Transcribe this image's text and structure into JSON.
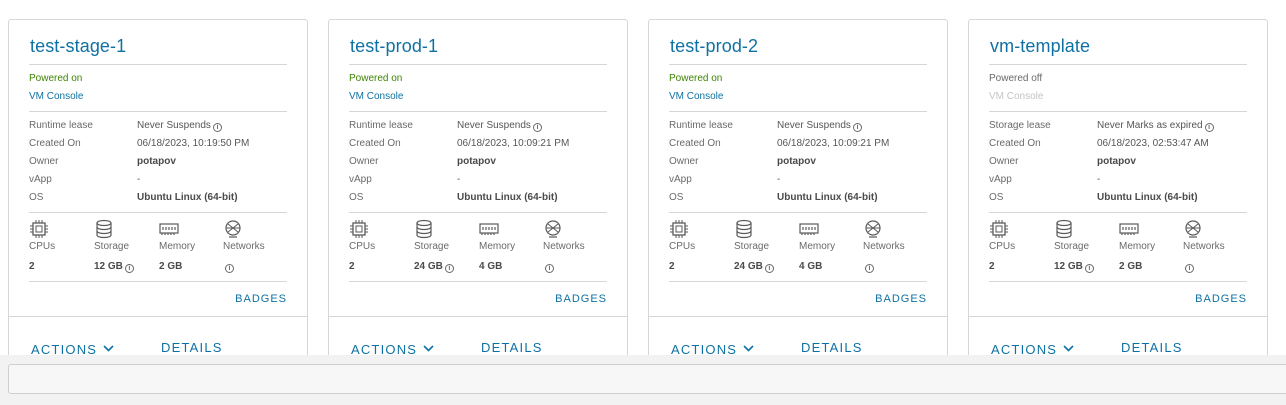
{
  "colors": {
    "link": "#0f71a3",
    "powered_on": "#3c8500",
    "border": "#d7d7d7"
  },
  "labels": {
    "runtime_lease": "Runtime lease",
    "storage_lease": "Storage lease",
    "created_on": "Created On",
    "owner": "Owner",
    "vapp": "vApp",
    "os": "OS",
    "cpus": "CPUs",
    "storage": "Storage",
    "memory": "Memory",
    "networks": "Networks",
    "badges": "BADGES",
    "actions": "ACTIONS",
    "details": "DETAILS",
    "vm_console": "VM Console"
  },
  "cards": [
    {
      "name": "test-stage-1",
      "status": "Powered on",
      "lease_label": "Runtime lease",
      "lease_value": "Never Suspends",
      "created_on": "06/18/2023, 10:19:50 PM",
      "owner": "potapov",
      "vapp": "-",
      "os": "Ubuntu Linux (64-bit)",
      "cpus": "2",
      "storage": "12 GB",
      "memory": "2 GB"
    },
    {
      "name": "test-prod-1",
      "status": "Powered on",
      "lease_label": "Runtime lease",
      "lease_value": "Never Suspends",
      "created_on": "06/18/2023, 10:09:21 PM",
      "owner": "potapov",
      "vapp": "-",
      "os": "Ubuntu Linux (64-bit)",
      "cpus": "2",
      "storage": "24 GB",
      "memory": "4 GB"
    },
    {
      "name": "test-prod-2",
      "status": "Powered on",
      "lease_label": "Runtime lease",
      "lease_value": "Never Suspends",
      "created_on": "06/18/2023, 10:09:21 PM",
      "owner": "potapov",
      "vapp": "-",
      "os": "Ubuntu Linux (64-bit)",
      "cpus": "2",
      "storage": "24 GB",
      "memory": "4 GB"
    },
    {
      "name": "vm-template",
      "status": "Powered off",
      "lease_label": "Storage lease",
      "lease_value": "Never Marks as expired",
      "created_on": "06/18/2023, 02:53:47 AM",
      "owner": "potapov",
      "vapp": "-",
      "os": "Ubuntu Linux (64-bit)",
      "cpus": "2",
      "storage": "12 GB",
      "memory": "2 GB"
    }
  ]
}
